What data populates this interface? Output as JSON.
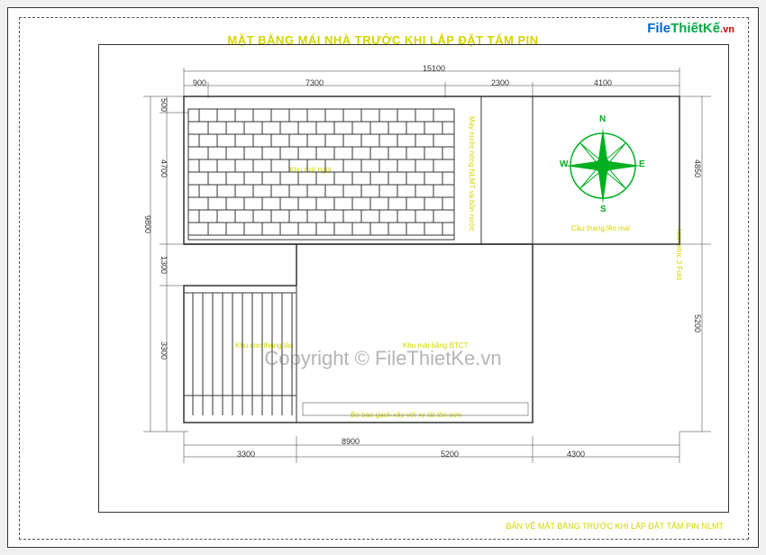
{
  "watermark": {
    "prefix": "F",
    "mid": "ile",
    "tk": "ThiếtKế",
    "vn": ".vn"
  },
  "copyright": "Copyright © FileThietKe.vn",
  "title": "MẶT BẰNG MÁI NHÀ TRƯỚC KHI LẮP ĐẶT TẤM PIN",
  "footer": "BẢN VẼ MẶT BẰNG TRƯỚC KHI LẮP ĐẶT TẤM PIN NLMT",
  "dims": {
    "top_total": "15100",
    "top_a": "900",
    "top_b": "7300",
    "top_c": "2300",
    "top_d": "4100",
    "left_total": "9800",
    "left_a": "500",
    "left_b": "4700",
    "left_c": "1300",
    "left_d": "3300",
    "right_a": "4850",
    "right_b": "5200",
    "bottom_total": "8900",
    "bottom_a": "3300",
    "bottom_b": "5200",
    "bottom_c": "4300"
  },
  "labels": {
    "roof1": "Khu mái ngói",
    "roof2": "Khu con thang lầu",
    "roof3": "Khu mái bằng BTCT",
    "roof_right": "Máy nước nóng NLMT và bồn nước",
    "stairs": "Cầu thang lên mái",
    "isometric": "Isometric 3 Fold",
    "gutter": "Bo bao gạch xây với xy lát tôn sơn"
  },
  "compass": {
    "n": "N",
    "e": "E",
    "s": "S",
    "w": "W"
  },
  "chart_data": {
    "type": "floor-plan",
    "title": "Roof plan before solar panel installation",
    "units": "mm",
    "overall_width": 15100,
    "overall_height": 9800,
    "horizontal_segments": [
      900,
      7300,
      2300,
      4100
    ],
    "vertical_segments_left": [
      500,
      4700,
      1300,
      3300
    ],
    "vertical_segments_right": [
      4850,
      5200
    ],
    "bottom_segments": [
      3300,
      5200,
      4300
    ],
    "zones": [
      {
        "name": "Khu mái ngói",
        "type": "tiled-roof"
      },
      {
        "name": "Khu con thang lầu",
        "type": "stair"
      },
      {
        "name": "Khu mái bằng BTCT",
        "type": "flat-concrete-roof"
      },
      {
        "name": "Cầu thang lên mái",
        "type": "roof-access-stair"
      },
      {
        "name": "Máy nước nóng NLMT và bồn nước",
        "type": "water-heater"
      }
    ],
    "orientation_marker": true
  }
}
